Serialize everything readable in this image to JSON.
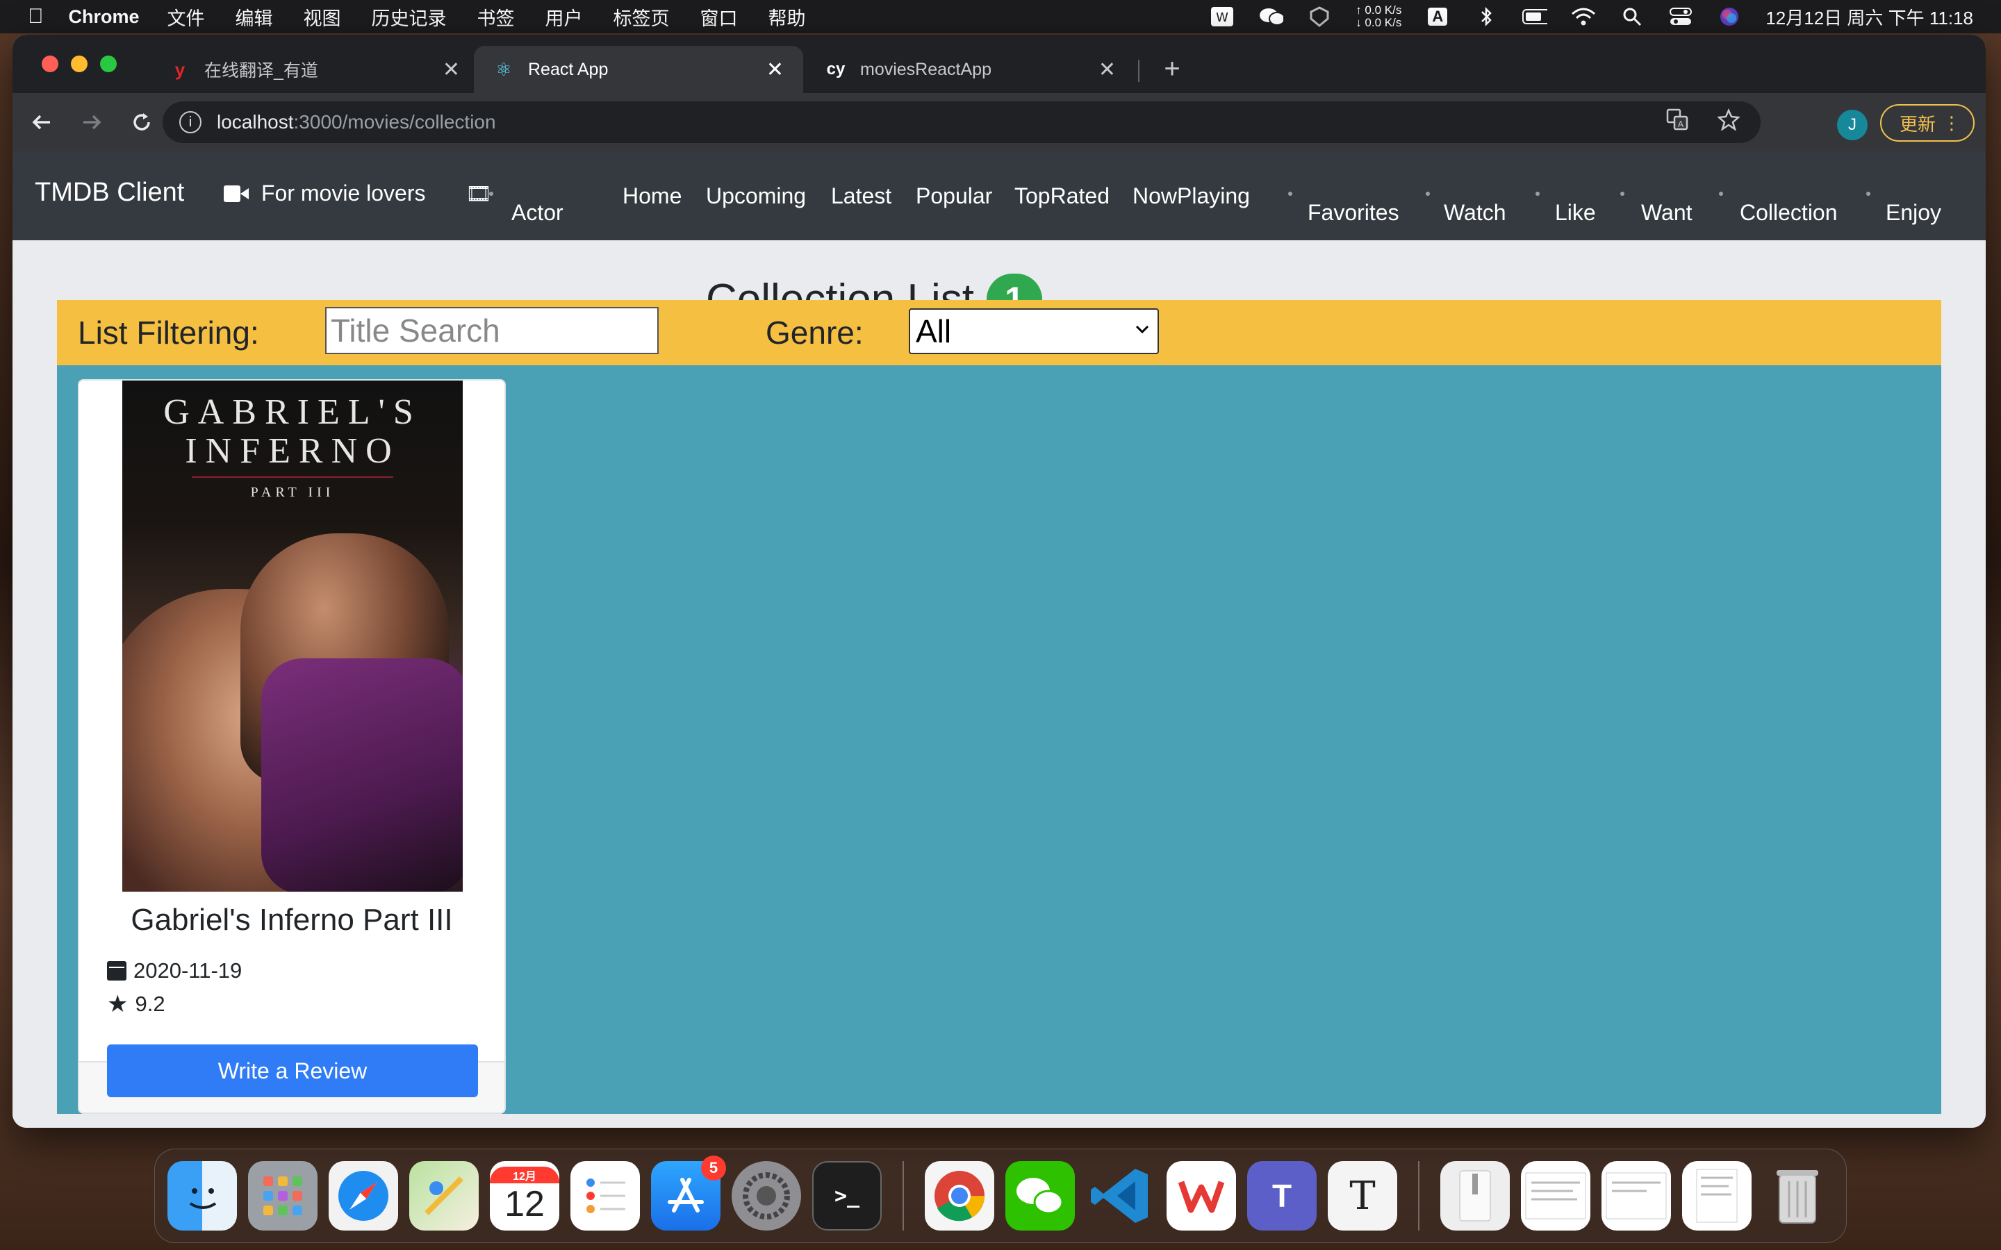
{
  "menubar": {
    "apple": "",
    "app_name": "Chrome",
    "items": [
      "文件",
      "编辑",
      "视图",
      "历史记录",
      "书签",
      "用户",
      "标签页",
      "窗口",
      "帮助"
    ],
    "net_up": "↑ 0.0 K/s",
    "net_down": "↓ 0.0 K/s",
    "input_method": "A",
    "clock": "12月12日 周六 下午 11:18"
  },
  "browser": {
    "tabs": [
      {
        "favicon": "y",
        "label": "在线翻译_有道",
        "close": "✕"
      },
      {
        "favicon": "⚛",
        "label": "React App",
        "close": "✕"
      },
      {
        "favicon": "cy",
        "label": "moviesReactApp",
        "close": "✕"
      }
    ],
    "new_tab": "+",
    "url_host": "localhost",
    "url_path": ":3000/movies/collection",
    "avatar_letter": "J",
    "update_label": "更新"
  },
  "appnav": {
    "brand": "TMDB Client",
    "tagline": "For movie lovers",
    "actor": "Actor",
    "links": [
      "Home",
      "Upcoming",
      "Latest",
      "Popular",
      "TopRated",
      "NowPlaying"
    ],
    "user_links": [
      "Favorites",
      "Watch",
      "Like",
      "Want",
      "Collection",
      "Enjoy"
    ]
  },
  "page": {
    "heading": "Collection List",
    "count": "1",
    "filter_label": "List Filtering:",
    "title_placeholder": "Title Search",
    "genre_label": "Genre:",
    "genre_selected": "All"
  },
  "movie": {
    "poster_title_1": "GABRIEL'S",
    "poster_title_2": "INFERNO",
    "poster_part": "PART III",
    "title": "Gabriel's Inferno Part III",
    "release_date": "2020-11-19",
    "rating": "9.2",
    "review_button": "Write a Review"
  },
  "dock": {
    "calendar_month": "12月",
    "calendar_day": "12",
    "app_store_badge": "5"
  }
}
